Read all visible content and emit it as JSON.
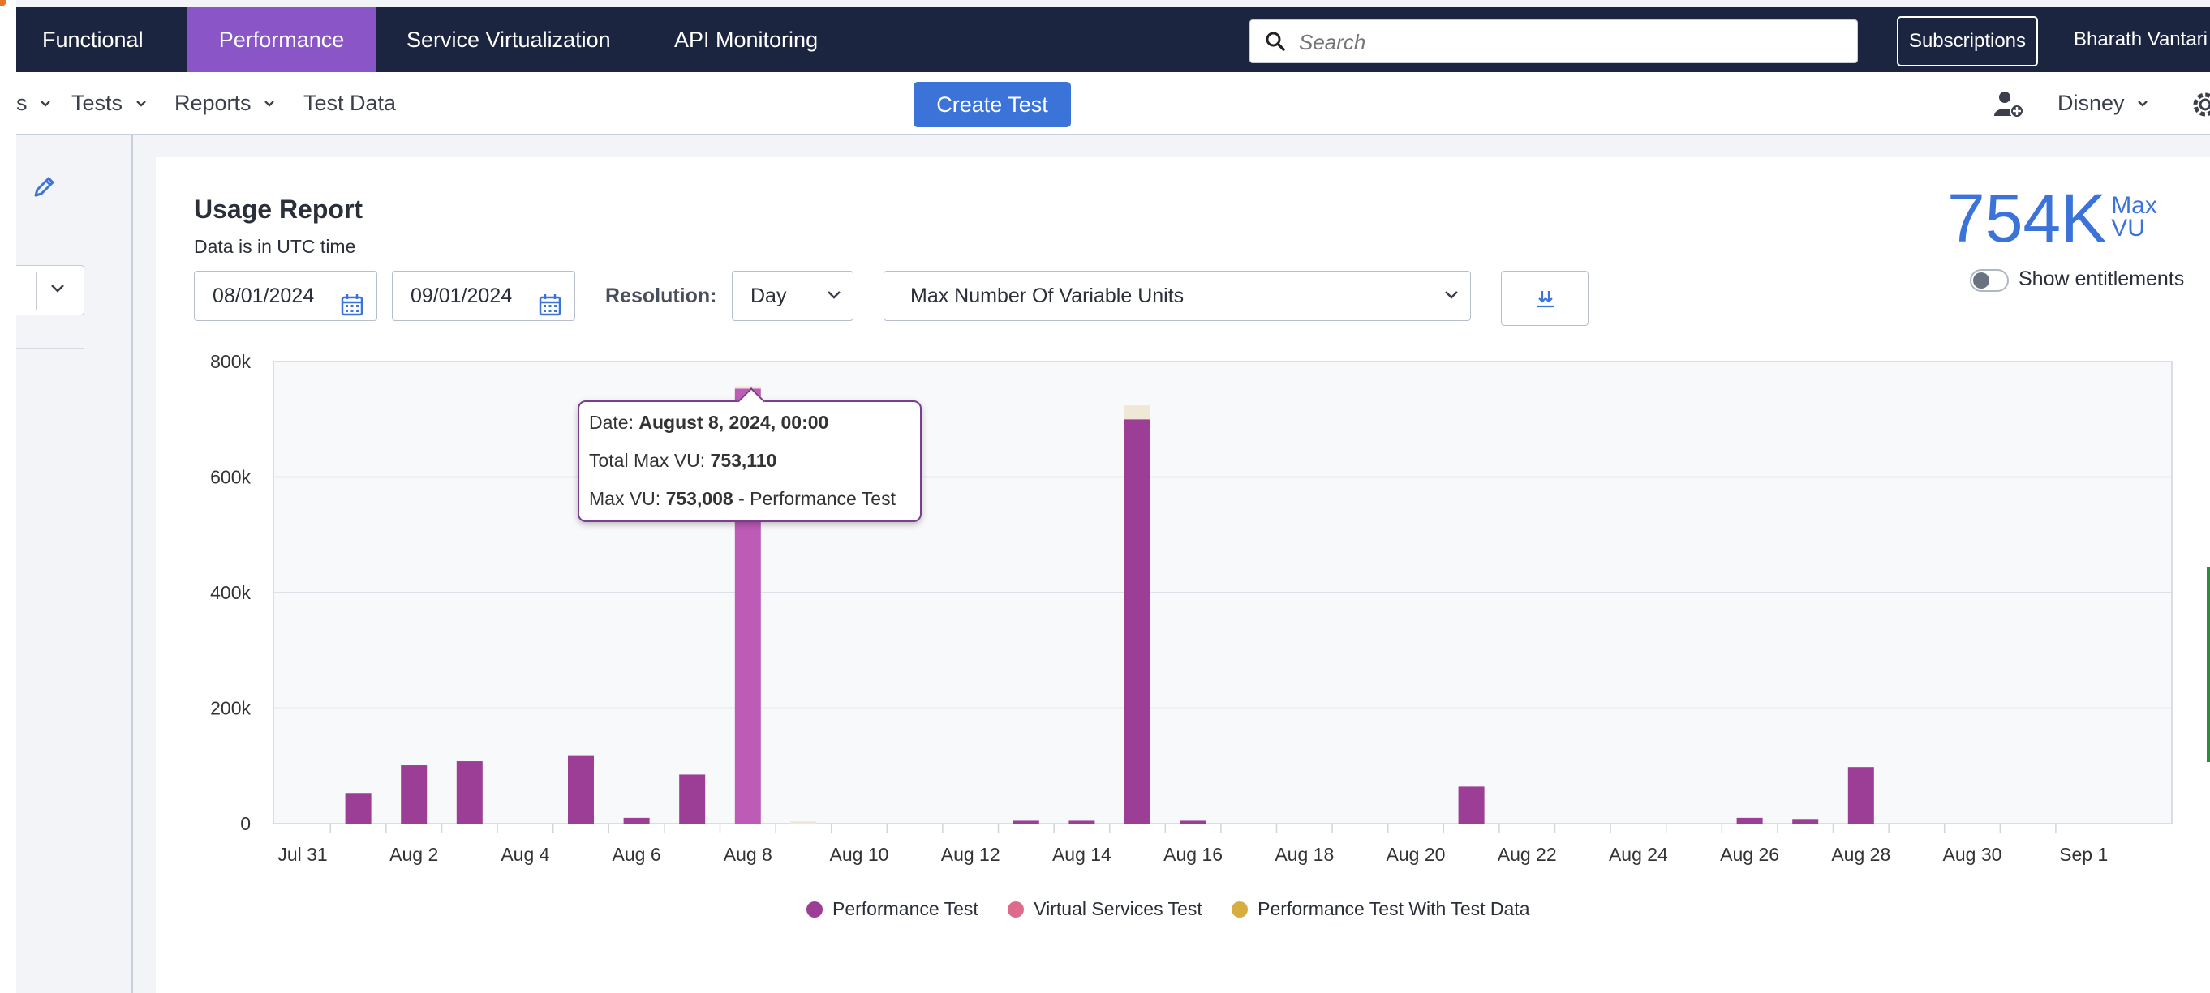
{
  "topnav": {
    "tabs": [
      {
        "label": "Functional",
        "active": false
      },
      {
        "label": "Performance",
        "active": true
      },
      {
        "label": "Service Virtualization",
        "active": false
      },
      {
        "label": "API Monitoring",
        "active": false
      }
    ],
    "search_placeholder": "Search",
    "subscriptions_label": "Subscriptions",
    "user_name": "Bharath Vantari",
    "active_color": "#8a55c6",
    "bg_color": "#1b2540"
  },
  "subnav": {
    "truncated_item": "s",
    "tests_label": "Tests",
    "reports_label": "Reports",
    "test_data_label": "Test Data",
    "create_test_label": "Create Test",
    "account_label": "Disney",
    "icons": [
      "add-user-icon",
      "gear-icon"
    ]
  },
  "report": {
    "title": "Usage Report",
    "subtitle": "Data is in UTC time",
    "start_date": "08/01/2024",
    "end_date": "09/01/2024",
    "resolution_label": "Resolution:",
    "resolution_value": "Day",
    "metric_value": "Max Number Of Variable Units",
    "max_value": "754K",
    "max_unit_line1": "Max",
    "max_unit_line2": "VU",
    "show_entitlements_label": "Show entitlements",
    "show_entitlements_on": false
  },
  "tooltip": {
    "date_label": "Date: ",
    "date_value": "August 8, 2024, 00:00",
    "total_label": "Total Max VU: ",
    "total_value": "753,110",
    "maxvu_label": "Max VU: ",
    "maxvu_value": "753,008",
    "maxvu_suffix": " - Performance Test"
  },
  "chart_data": {
    "type": "bar",
    "stacked": true,
    "x": [
      "2024-07-31",
      "2024-08-01",
      "2024-08-02",
      "2024-08-03",
      "2024-08-04",
      "2024-08-05",
      "2024-08-06",
      "2024-08-07",
      "2024-08-08",
      "2024-08-09",
      "2024-08-10",
      "2024-08-11",
      "2024-08-12",
      "2024-08-13",
      "2024-08-14",
      "2024-08-15",
      "2024-08-16",
      "2024-08-17",
      "2024-08-18",
      "2024-08-19",
      "2024-08-20",
      "2024-08-21",
      "2024-08-22",
      "2024-08-23",
      "2024-08-24",
      "2024-08-25",
      "2024-08-26",
      "2024-08-27",
      "2024-08-28",
      "2024-08-29",
      "2024-08-30",
      "2024-08-31",
      "2024-09-01"
    ],
    "x_tick_labels": [
      "Jul 31",
      "Aug 2",
      "Aug 4",
      "Aug 6",
      "Aug 8",
      "Aug 10",
      "Aug 12",
      "Aug 14",
      "Aug 16",
      "Aug 18",
      "Aug 20",
      "Aug 22",
      "Aug 24",
      "Aug 26",
      "Aug 28",
      "Aug 30",
      "Sep 1"
    ],
    "y_tick_labels": [
      "0",
      "200k",
      "400k",
      "600k",
      "800k"
    ],
    "ylim": [
      0,
      800000
    ],
    "grid": true,
    "legend_position": "bottom",
    "highlighted_index": 8,
    "series": [
      {
        "name": "Performance Test",
        "color": "#9c3d96",
        "values": [
          0,
          53000,
          101000,
          108000,
          0,
          117000,
          10000,
          85000,
          753008,
          0,
          0,
          0,
          0,
          5000,
          5000,
          700000,
          5000,
          0,
          0,
          0,
          0,
          64000,
          0,
          0,
          0,
          0,
          10000,
          8000,
          98000,
          0,
          0,
          0,
          0
        ]
      },
      {
        "name": "Virtual Services Test",
        "color": "#de6b8c",
        "values": [
          0,
          0,
          0,
          0,
          0,
          0,
          0,
          0,
          0,
          0,
          0,
          0,
          0,
          0,
          0,
          0,
          0,
          0,
          0,
          0,
          0,
          0,
          0,
          0,
          0,
          0,
          0,
          0,
          0,
          0,
          0,
          0,
          0
        ]
      },
      {
        "name": "Performance Test With Test Data",
        "color": "#d7ad3f",
        "values": [
          0,
          0,
          0,
          0,
          0,
          0,
          0,
          0,
          102,
          4000,
          0,
          0,
          0,
          0,
          0,
          24000,
          0,
          0,
          0,
          0,
          0,
          0,
          0,
          0,
          0,
          0,
          0,
          0,
          0,
          0,
          0,
          0,
          0
        ]
      }
    ]
  }
}
